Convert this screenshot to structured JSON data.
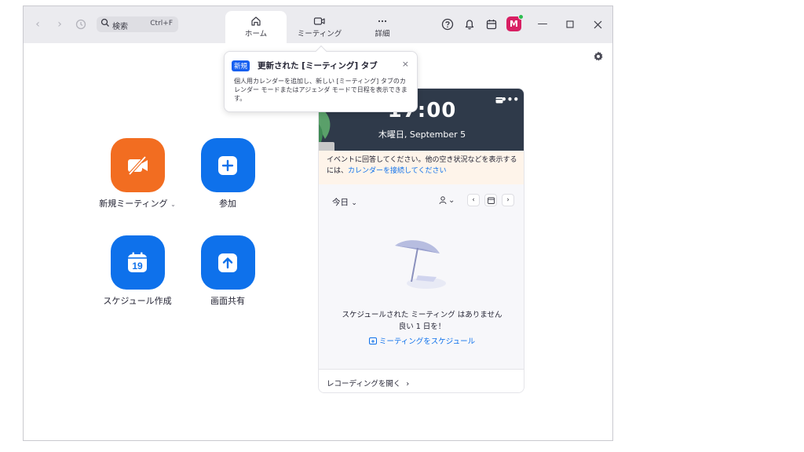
{
  "topbar": {
    "search_label": "検索",
    "search_shortcut": "Ctrl+F",
    "tabs": [
      {
        "label": "ホーム"
      },
      {
        "label": "ミーティング"
      },
      {
        "label": "詳細"
      }
    ],
    "avatar_initial": "M"
  },
  "popup": {
    "badge": "新規",
    "title": "更新された [ミーティング] タブ",
    "body": "個人用カレンダーを追加し、新しい [ミーティング] タブのカレンダー モードまたはアジェンダ モードで日程を表示できます。",
    "close": "×"
  },
  "actions": {
    "new_meeting": "新規ミーティング",
    "join": "参加",
    "schedule": "スケジュール作成",
    "schedule_day": "19",
    "share_screen": "画面共有"
  },
  "calendar": {
    "time": "17:00",
    "date": "木曜日, September 5",
    "notice_text": "イベントに回答してください。他の空き状況などを表示するには、",
    "notice_link": "カレンダーを接続してください",
    "today": "今日",
    "empty_line1": "スケジュールされた ミーティング はありません",
    "empty_line2": "良い 1 日を！",
    "schedule_link": "ミーティングをスケジュール",
    "recordings_link": "レコーディングを開く"
  },
  "colors": {
    "accent_blue": "#0e71eb",
    "orange": "#f26d21",
    "avatar": "#d81f63",
    "clock_bg": "#2f3a4a"
  }
}
